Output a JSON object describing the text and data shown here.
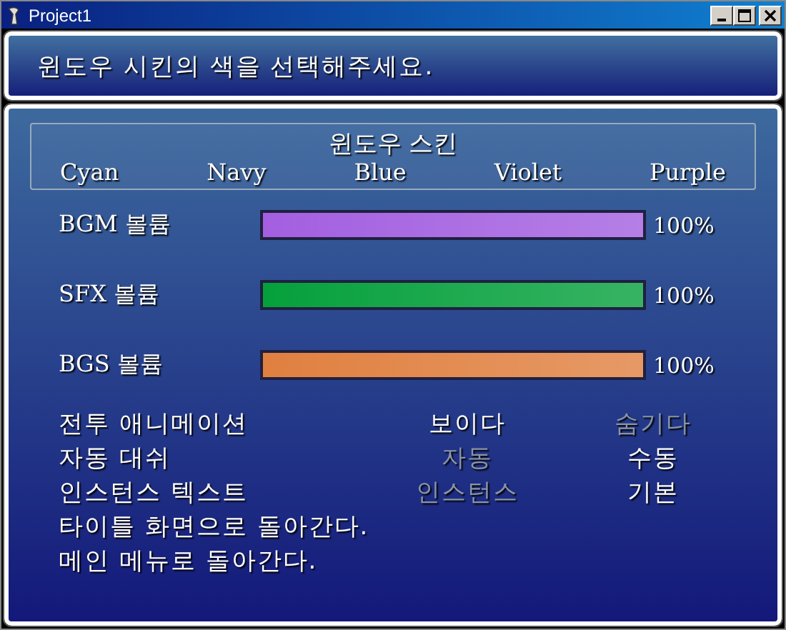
{
  "window": {
    "title": "Project1"
  },
  "help": "윈도우 시킨의 색을 선택해주세요.",
  "skin": {
    "title": "윈도우 스킨",
    "options": [
      "Cyan",
      "Navy",
      "Blue",
      "Violet",
      "Purple"
    ]
  },
  "volumes": [
    {
      "label": "BGM 볼륨",
      "level": 1,
      "reading": "100%",
      "color": "#a35fe0"
    },
    {
      "label": "SFX 볼륨",
      "level": 1,
      "reading": "100%",
      "color": "#05a03c"
    },
    {
      "label": "BGS 볼륨",
      "level": 1,
      "reading": "100%",
      "color": "#e08040"
    }
  ],
  "options": [
    {
      "label": "전투 애니메이션",
      "choices": [
        {
          "label": "보이다",
          "selected": true
        },
        {
          "label": "숨기다",
          "selected": false
        }
      ]
    },
    {
      "label": "자동 대쉬",
      "choices": [
        {
          "label": "자동",
          "selected": false
        },
        {
          "label": "수동",
          "selected": true
        }
      ]
    },
    {
      "label": "인스턴스 텍스트",
      "choices": [
        {
          "label": "인스턴스",
          "selected": false
        },
        {
          "label": "기본",
          "selected": true
        }
      ]
    }
  ],
  "commands": [
    "타이틀 화면으로 돌아간다.",
    "메인 메뉴로 돌아간다."
  ]
}
